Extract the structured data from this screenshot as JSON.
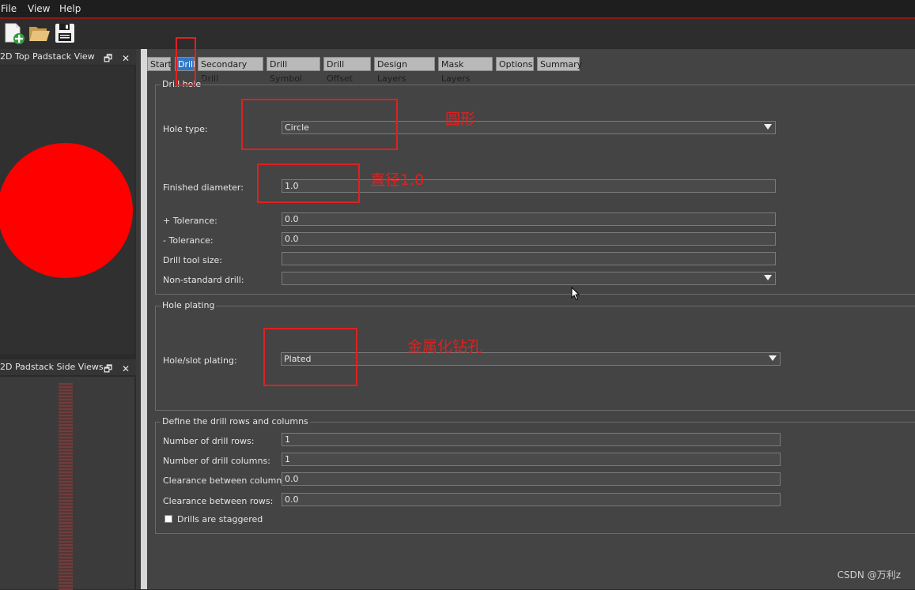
{
  "menubar": {
    "file": "File",
    "view": "View",
    "help": "Help"
  },
  "toolbar": {
    "icons": [
      "new-file-icon",
      "open-folder-icon",
      "save-disk-icon"
    ]
  },
  "left_panels": {
    "top_view_title": "2D Top Padstack View",
    "side_view_title": "2D Padstack Side Views",
    "float_glyph": "🗗",
    "close_glyph": "✕"
  },
  "tabs": [
    {
      "label": "Start",
      "active": false
    },
    {
      "label": "Drill",
      "active": true
    },
    {
      "label": "Secondary Drill",
      "active": false
    },
    {
      "label": "Drill Symbol",
      "active": false
    },
    {
      "label": "Drill Offset",
      "active": false
    },
    {
      "label": "Design Layers",
      "active": false
    },
    {
      "label": "Mask Layers",
      "active": false
    },
    {
      "label": "Options",
      "active": false
    },
    {
      "label": "Summary",
      "active": false
    }
  ],
  "drill_hole": {
    "title": "Drill hole",
    "hole_type_label": "Hole type:",
    "hole_type_value": "Circle",
    "finished_diameter_label": "Finished diameter:",
    "finished_diameter_value": "1.0",
    "plus_tol_label": "+ Tolerance:",
    "plus_tol_value": "0.0",
    "minus_tol_label": "- Tolerance:",
    "minus_tol_value": "0.0",
    "drill_tool_label": "Drill tool size:",
    "drill_tool_value": "",
    "non_standard_label": "Non-standard drill:",
    "non_standard_value": ""
  },
  "hole_plating": {
    "title": "Hole plating",
    "label": "Hole/slot plating:",
    "value": "Plated"
  },
  "drill_rows": {
    "title": "Define the drill rows and columns",
    "rows_label": "Number of drill rows:",
    "rows_value": "1",
    "cols_label": "Number of drill columns:",
    "cols_value": "1",
    "clear_cols_label": "Clearance between columns:",
    "clear_cols_value": "0.0",
    "clear_rows_label": "Clearance between rows:",
    "clear_rows_value": "0.0",
    "staggered_label": "Drills are staggered"
  },
  "annotations": {
    "circle": "圆形",
    "diameter": "直径1.0",
    "plated": "金属化钻孔"
  },
  "colors": {
    "pad": "#ff0000",
    "annotation": "#e02020",
    "active_tab": "#2f78c8"
  },
  "watermark": "CSDN @万利z"
}
